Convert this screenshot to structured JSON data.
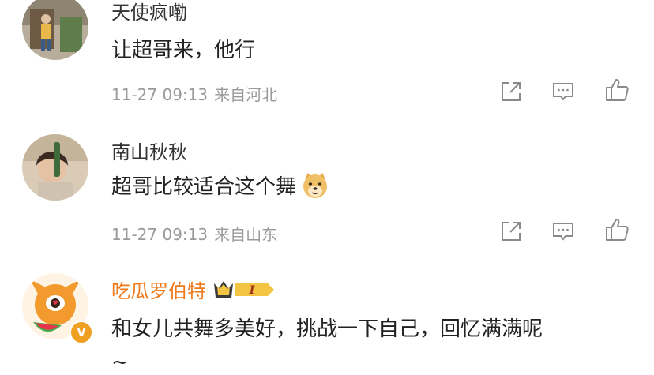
{
  "comments": [
    {
      "username": "天使疯嘞",
      "text": "让超哥来，他行",
      "timestamp": "11-27 09:13",
      "location": "来自河北"
    },
    {
      "username": "南山秋秋",
      "text": "超哥比较适合这个舞",
      "emoji": "doge-emoji",
      "timestamp": "11-27 09:13",
      "location": "来自山东"
    },
    {
      "username": "吃瓜罗伯特",
      "badge_level": "I",
      "verified_label": "V",
      "text": "和女儿共舞多美好，挑战一下自己，回忆满满呢",
      "text_cont": "~"
    }
  ],
  "icons": {
    "share": "share-icon",
    "reply": "comment-icon",
    "like": "like-icon"
  },
  "colors": {
    "vip_name": "#ee7a1c",
    "meta": "#9a9a9a",
    "icon": "#8a8a8a"
  }
}
